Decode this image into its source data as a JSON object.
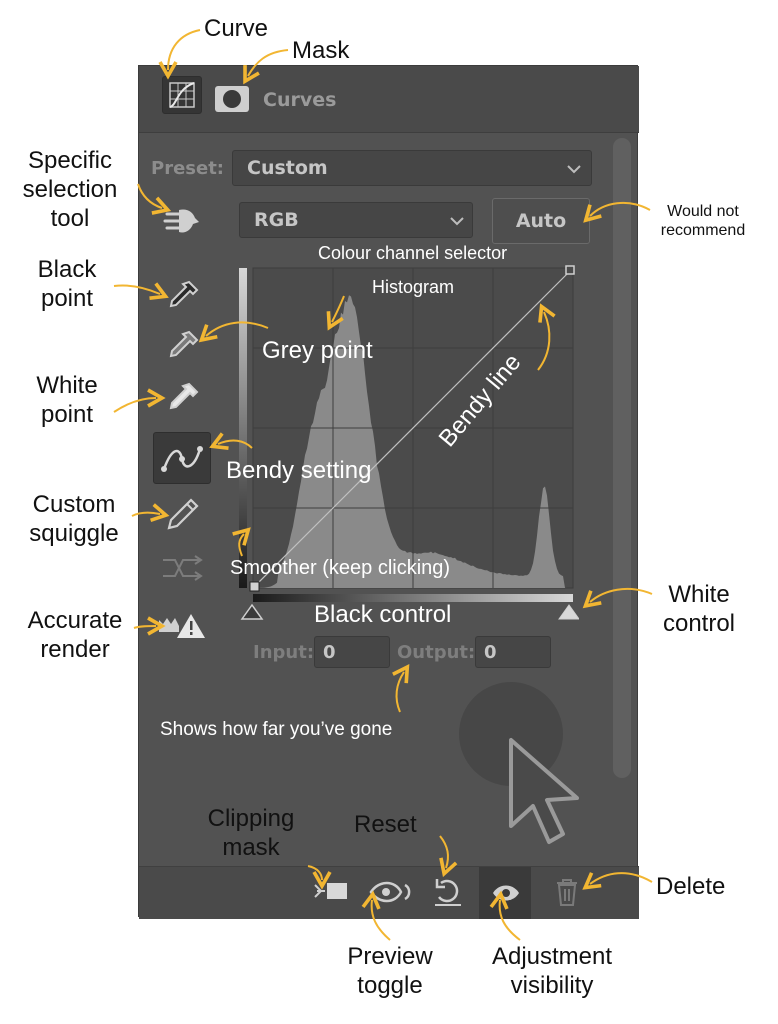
{
  "panel": {
    "title": "Curves",
    "preset_label": "Preset:",
    "preset_value": "Custom",
    "channel_value": "RGB",
    "auto_button": "Auto",
    "input_label": "Input:",
    "input_value": "0",
    "output_label": "Output:",
    "output_value": "0"
  },
  "annotations": {
    "curve": "Curve",
    "mask": "Mask",
    "specific_selection": [
      "Specific",
      "selection",
      "tool"
    ],
    "would_not": [
      "Would not",
      "recommend"
    ],
    "colour_channel": "Colour channel selector",
    "histogram": "Histogram",
    "black_point": [
      "Black",
      "point"
    ],
    "grey_point": "Grey point",
    "white_point": [
      "White",
      "point"
    ],
    "bendy_line": "Bendy line",
    "bendy_setting": "Bendy setting",
    "custom_squiggle": [
      "Custom",
      "squiggle"
    ],
    "smoother": "Smoother (keep clicking)",
    "accurate_render": [
      "Accurate",
      "render"
    ],
    "black_control": "Black control",
    "white_control": [
      "White",
      "control"
    ],
    "shows_how_far": "Shows how far you’ve gone",
    "clipping_mask": [
      "Clipping",
      "mask"
    ],
    "reset": "Reset",
    "delete": "Delete",
    "preview_toggle": [
      "Preview",
      "toggle"
    ],
    "adjustment_visibility": [
      "Adjustment",
      "visibility"
    ]
  },
  "colors": {
    "panel_bg": "#525252",
    "arrow": "#f2b632",
    "histogram_fill": "#8a8a8a"
  },
  "icons": [
    "curve-icon",
    "mask-icon",
    "targeted-adjustment-icon",
    "black-eyedropper-icon",
    "grey-eyedropper-icon",
    "white-eyedropper-icon",
    "curve-points-icon",
    "pencil-icon",
    "smooth-icon",
    "clipping-warning-icon",
    "clip-to-layer-icon",
    "preview-eye-icon",
    "reset-icon",
    "visibility-eye-icon",
    "trash-icon",
    "cursor-arrow-icon"
  ]
}
